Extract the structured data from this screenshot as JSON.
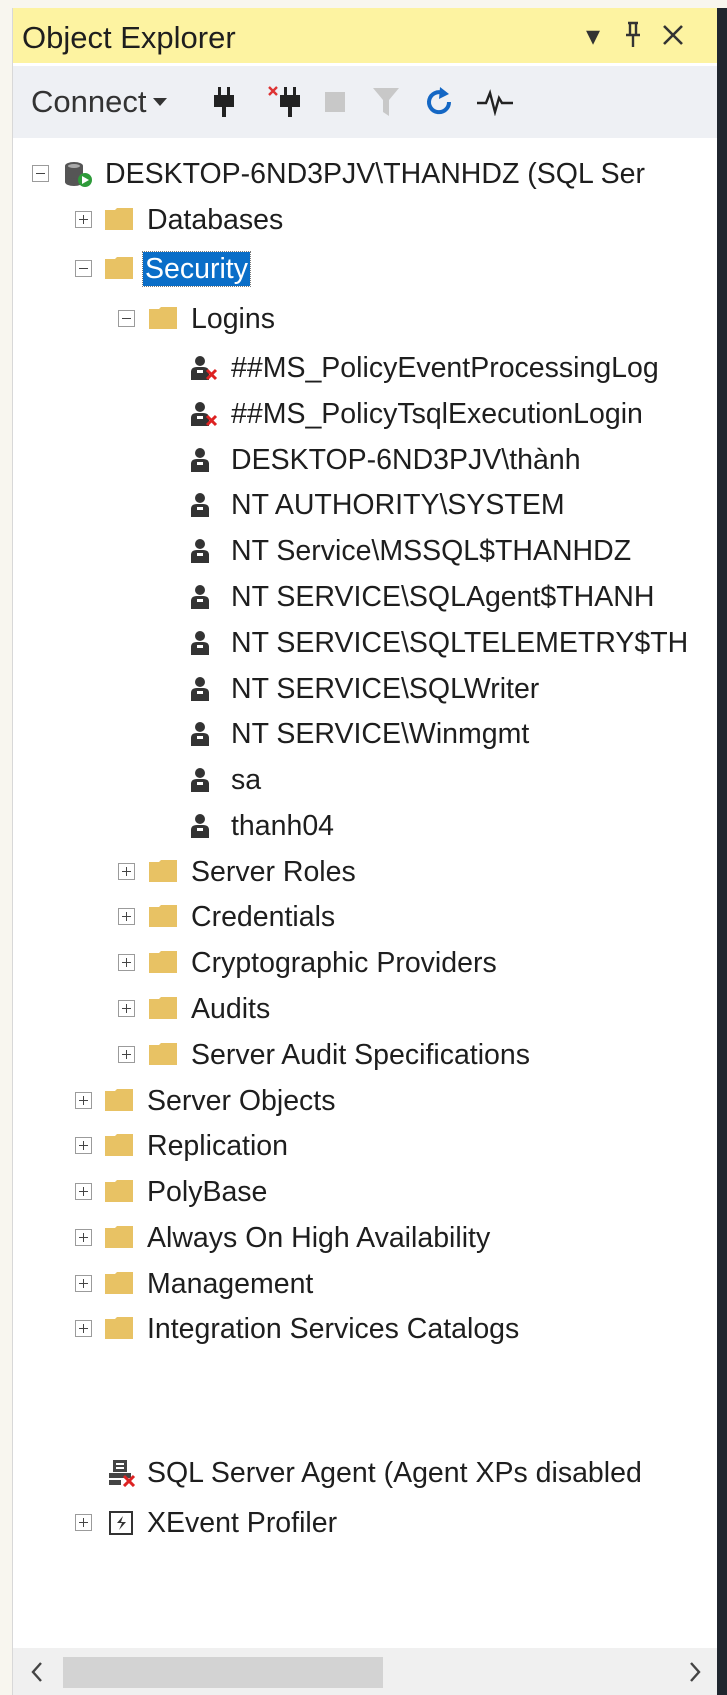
{
  "panel": {
    "title": "Object Explorer",
    "buttons": {
      "dropdown": "▾",
      "pin": "pin-icon",
      "close": "close-icon"
    }
  },
  "toolbar": {
    "connect_label": "Connect",
    "tools": [
      "connect-icon",
      "disconnect-icon",
      "stop-icon",
      "filter-icon",
      "refresh-icon",
      "activity-monitor-icon"
    ]
  },
  "tree": {
    "server": "DESKTOP-6ND3PJV\\THANHDZ (SQL Ser",
    "databases": "Databases",
    "security": {
      "label": "Security",
      "logins": {
        "label": "Logins",
        "items": [
          {
            "name": "##MS_PolicyEventProcessingLog",
            "disabled": true
          },
          {
            "name": "##MS_PolicyTsqlExecutionLogin",
            "disabled": true
          },
          {
            "name": "DESKTOP-6ND3PJV\\thành",
            "disabled": false
          },
          {
            "name": "NT AUTHORITY\\SYSTEM",
            "disabled": false
          },
          {
            "name": "NT Service\\MSSQL$THANHDZ",
            "disabled": false
          },
          {
            "name": "NT SERVICE\\SQLAgent$THANH",
            "disabled": false
          },
          {
            "name": "NT SERVICE\\SQLTELEMETRY$TH",
            "disabled": false
          },
          {
            "name": "NT SERVICE\\SQLWriter",
            "disabled": false
          },
          {
            "name": "NT SERVICE\\Winmgmt",
            "disabled": false
          },
          {
            "name": "sa",
            "disabled": false
          },
          {
            "name": "thanh04",
            "disabled": false
          }
        ]
      },
      "children": [
        "Server Roles",
        "Credentials",
        "Cryptographic Providers",
        "Audits",
        "Server Audit Specifications"
      ]
    },
    "top_level": [
      "Server Objects",
      "Replication",
      "PolyBase",
      "Always On High Availability",
      "Management",
      "Integration Services Catalogs"
    ],
    "agent": "SQL Server Agent (Agent XPs disabled",
    "xevent": "XEvent Profiler"
  },
  "colors": {
    "title_bg": "#fdf3a1",
    "selection": "#0a6ec8",
    "folder": "#e8c264"
  }
}
